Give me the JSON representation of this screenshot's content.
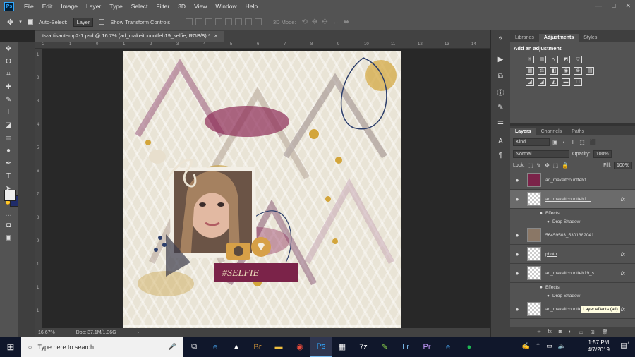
{
  "menu": [
    "File",
    "Edit",
    "Image",
    "Layer",
    "Type",
    "Select",
    "Filter",
    "3D",
    "View",
    "Window",
    "Help"
  ],
  "options": {
    "auto_select": "Auto-Select:",
    "auto_select_value": "Layer",
    "transform": "Show Transform Controls",
    "mode3d": "3D Mode:"
  },
  "document": {
    "tab_title": "ts-artisantemp2-1.psd @ 16.7% (ad_makeitcountfeb19_selfie, RGB/8) *",
    "close": "×"
  },
  "status": {
    "zoom": "16.67%",
    "doc": "Doc: 37.1M/1.36G"
  },
  "ruler_h": [
    "2",
    "1",
    "0",
    "1",
    "2",
    "3",
    "4",
    "5",
    "6",
    "7",
    "8",
    "9",
    "10",
    "11",
    "12",
    "13",
    "14"
  ],
  "ruler_v": [
    "1",
    "2",
    "3",
    "4",
    "5",
    "6",
    "7",
    "8",
    "9",
    "1",
    "1",
    "1"
  ],
  "panels": {
    "tabs_top": [
      "Libraries",
      "Adjustments",
      "Styles"
    ],
    "adjustments_title": "Add an adjustment",
    "tabs_layers": [
      "Layers",
      "Channels",
      "Paths"
    ],
    "filter": "Kind",
    "blend": "Normal",
    "opacity_label": "Opacity:",
    "opacity": "100%",
    "lock_label": "Lock:",
    "fill_label": "Fill:",
    "fill": "100%"
  },
  "layers": [
    {
      "name": "ad_makeitcountfeb1...",
      "fx": ""
    },
    {
      "name": "ad_makeitcountfeb1...",
      "fx": "fx"
    },
    {
      "name": "56459503_5301382041...",
      "fx": ""
    },
    {
      "name": "photo",
      "fx": "fx"
    },
    {
      "name": "ad_makeitcountfeb19_s...",
      "fx": "fx"
    },
    {
      "name": "ad_makeitcountfeb19_s...",
      "fx": "fx"
    }
  ],
  "effects": {
    "effects": "Effects",
    "drop_shadow": "Drop Shadow"
  },
  "tooltip": "Layer effects (all)",
  "taskbar": {
    "search": "Type here to search",
    "time": "1:57 PM",
    "date": "4/7/2019",
    "notif_count": "7"
  },
  "art": {
    "tag": "#SELFIE"
  },
  "colors": {
    "bg_panel": "#535353",
    "canvas_bg": "#282828",
    "fg_swatch": "#eeeeee",
    "bg_swatch": "#1f2c6a",
    "wine": "#7b2349",
    "mustard": "#d3a53a"
  }
}
